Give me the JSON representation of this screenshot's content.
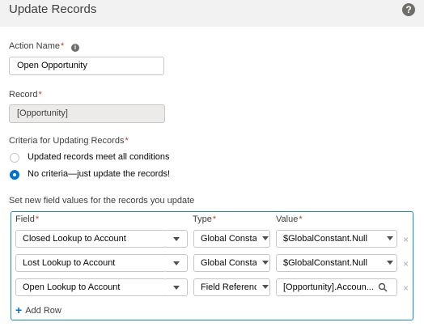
{
  "header": {
    "title": "Update Records",
    "help_icon": "question-circle-icon"
  },
  "form": {
    "action_name": {
      "label": "Action Name",
      "required_mark": "*",
      "value": "Open Opportunity"
    },
    "record": {
      "label": "Record",
      "required_mark": "*",
      "value": "[Opportunity]"
    },
    "criteria": {
      "label": "Criteria for Updating Records",
      "required_mark": "*",
      "options": [
        {
          "label": "Updated records meet all conditions",
          "selected": false
        },
        {
          "label": "No criteria—just update the records!",
          "selected": true
        }
      ]
    },
    "field_values": {
      "label": "Set new field values for the records you update",
      "headers": {
        "field": "Field",
        "type": "Type",
        "value": "Value",
        "required_mark": "*"
      },
      "rows": [
        {
          "field": "Closed Lookup to Account",
          "type": "Global Constant",
          "value": "$GlobalConstant.Null"
        },
        {
          "field": "Lost Lookup to Account",
          "type": "Global Constant",
          "value": "$GlobalConstant.Null"
        },
        {
          "field": "Open Lookup to Account",
          "type": "Field Reference",
          "value": "[Opportunity].Accoun..."
        }
      ],
      "remove_glyph": "×",
      "add_row_label": "Add Row"
    }
  },
  "colors": {
    "accent": "#0070d2",
    "required": "#c23934",
    "focus_border": "#1589ee"
  }
}
